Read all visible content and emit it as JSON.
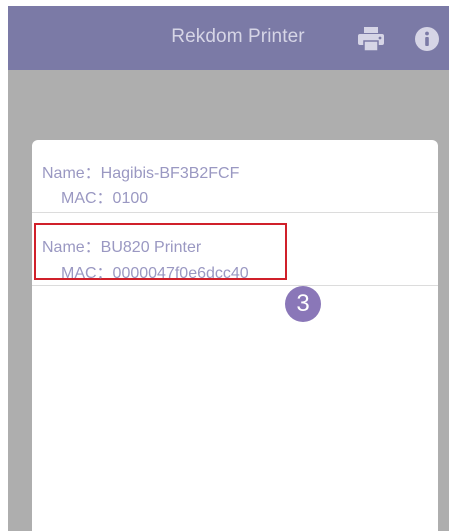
{
  "navbar": {
    "title": "Rekdom Printer",
    "print_icon": "printer-icon",
    "info_icon": "info-icon"
  },
  "device_list": [
    {
      "name_label": "Name：Hagibis-BF3B2FCF",
      "mac_label": "MAC：0100"
    },
    {
      "name_label": "Name：BU820 Printer",
      "mac_label": "MAC：0000047f0e6dcc40"
    }
  ],
  "annotation": {
    "step": "3",
    "highlight_color": "#d0202a",
    "badge_color": "#8a77b8"
  },
  "colors": {
    "navbar": "#7b7aa6",
    "overlay": "#aeaeae",
    "text": "#9a98c2"
  }
}
